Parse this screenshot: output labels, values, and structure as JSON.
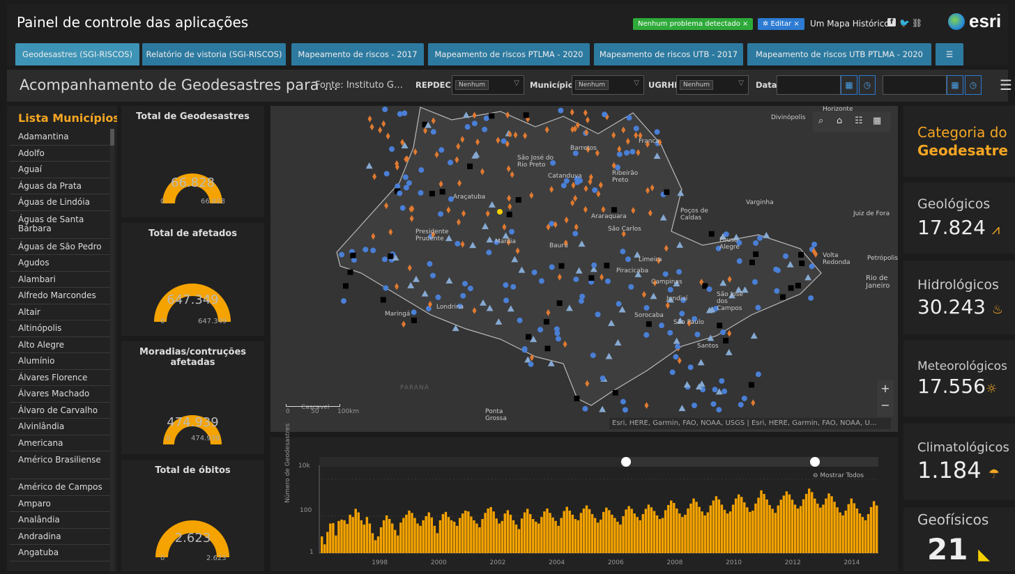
{
  "header": {
    "title": "Painel de controle das aplicações",
    "status_badge": "Nenhum problema detectado ×",
    "edit_badge": "✲ Editar ×",
    "map_link": "Um Mapa Histórico",
    "logo_text": "esri"
  },
  "tabs": [
    {
      "label": "Geodesastres (SGI-RISCOS)"
    },
    {
      "label": "Relatório de vistoria (SGI-RISCOS)"
    },
    {
      "label": "Mapeamento de riscos - 2017"
    },
    {
      "label": "Mapeamento de riscos PTLMA - 2020"
    },
    {
      "label": "Mapeamento de riscos UTB - 2017"
    },
    {
      "label": "Mapeamento de riscos UTB PTLMA - 2020"
    }
  ],
  "filters": {
    "title": "Acompanhamento de Geodesastres para …",
    "source": "Fonte: Instituto G…",
    "repdec_label": "REPDEC",
    "repdec_value": "Nenhum",
    "municipio_label": "Município",
    "municipio_value": "Nenhum",
    "ugrhi_label": "UGRHI",
    "ugrhi_value": "Nenhum",
    "data_label": "Data"
  },
  "municipios": {
    "title": "Lista Municípios",
    "items": [
      "Adamantina",
      "Adolfo",
      "Aguaí",
      "Águas da Prata",
      "Águas de Lindóia",
      "Águas de Santa Bárbara",
      "Águas de São Pedro",
      "Agudos",
      "Alambari",
      "Alfredo Marcondes",
      "Altair",
      "Altinópolis",
      "Alto Alegre",
      "Alumínio",
      "Álvares Florence",
      "Álvares Machado",
      "Álvaro de Carvalho",
      "Alvinlândia",
      "Americana",
      "Américo Brasiliense",
      "Américo de Campos",
      "Amparo",
      "Analândia",
      "Andradina",
      "Angatuba"
    ]
  },
  "gauges": [
    {
      "title": "Total de Geodesastres",
      "value": "66.828",
      "min": "0",
      "max": "66.828",
      "fill": 1.0
    },
    {
      "title": "Total de afetados",
      "value": "647.349",
      "min": "0",
      "max": "647.349",
      "fill": 1.0
    },
    {
      "title": "Moradias/contruções afetadas",
      "value": "474.939",
      "min": "0",
      "max": "474.939",
      "fill": 1.0
    },
    {
      "title": "Total de óbitos",
      "value": "2.623",
      "min": "0",
      "max": "2.623",
      "fill": 1.0
    }
  ],
  "map": {
    "labels": {
      "divinopolis": "Divinópolis",
      "horizonte": "Horizonte",
      "barretos": "Barretos",
      "franca": "Franca",
      "sjrp": "São José do Rio Preto",
      "catanduva": "Catanduva",
      "ribeirao": "Ribeirão Preto",
      "aracatuba": "Araçatuba",
      "araraquara": "Araraquara",
      "sao_carlos": "São Carlos",
      "pocos": "Poços de Caldas",
      "varginha": "Varginha",
      "juiz": "Juiz de Fora",
      "pres_prudente": "Presidente Prudente",
      "marilia": "Marília",
      "bauru": "Bauru",
      "limeira": "Limeira",
      "piracicaba": "Piracicaba",
      "campinas": "Campinas",
      "pouso": "Pouso Alegre",
      "volta": "Volta Redonda",
      "petropolis": "Petrópolis",
      "rio": "Rio de Janeiro",
      "jundiai": "Jundiaí",
      "sjc": "São José dos Campos",
      "sorocaba": "Sorocaba",
      "sao_paulo": "São Paulo",
      "santos": "Santos",
      "londrina": "Londrina",
      "maringa": "Maringá",
      "parana": "PARANÁ",
      "ponta_grossa": "Ponta Grossa",
      "cascavel": "Cascavel"
    },
    "scale": {
      "zero": "0",
      "mid": "50",
      "end": "100km"
    },
    "attribution": "Esri, HERE, Garmin, FAO, NOAA, USGS | Esri, HERE, Garmin, FAO, NOAA, U…",
    "zoom_in": "+",
    "zoom_out": "−"
  },
  "chart_data": {
    "type": "bar",
    "ylabel": "Número de Geodesastres",
    "yscale": "log",
    "yticks": [
      "10k",
      "100",
      "1"
    ],
    "xticks": [
      "1998",
      "2000",
      "2002",
      "2004",
      "2006",
      "2008",
      "2010",
      "2012",
      "2014"
    ],
    "xrange": [
      1996.0,
      2014.9
    ],
    "show_all_label": "Mostrar Todos",
    "color": "#f5a300",
    "values": [
      8,
      3,
      14,
      40,
      42,
      9,
      55,
      65,
      60,
      38,
      120,
      90,
      250,
      160,
      60,
      35,
      90,
      40,
      12,
      5,
      8,
      25,
      60,
      110,
      70,
      40,
      18,
      9,
      45,
      80,
      120,
      200,
      150,
      80,
      40,
      30,
      60,
      100,
      160,
      85,
      30,
      12,
      60,
      130,
      170,
      90,
      60,
      50,
      30,
      80,
      140,
      200,
      180,
      95,
      60,
      40,
      25,
      70,
      150,
      260,
      310,
      180,
      75,
      40,
      55,
      140,
      210,
      120,
      60,
      35,
      20,
      75,
      160,
      250,
      130,
      70,
      50,
      40,
      90,
      180,
      260,
      150,
      85,
      55,
      30,
      80,
      190,
      320,
      200,
      120,
      70,
      60,
      150,
      260,
      380,
      240,
      130,
      80,
      45,
      65,
      170,
      290,
      210,
      120,
      80,
      50,
      35,
      100,
      230,
      350,
      250,
      140,
      90,
      60,
      130,
      250,
      420,
      300,
      190,
      110,
      70,
      80,
      210,
      400,
      700,
      520,
      260,
      140,
      90,
      120,
      260,
      480,
      900,
      600,
      320,
      180,
      110,
      160,
      380,
      700,
      1200,
      800,
      420,
      220,
      140,
      180,
      420,
      900,
      1500,
      1100,
      560,
      300,
      170,
      200,
      480,
      1000,
      2500,
      1600,
      800,
      400,
      250,
      150,
      380,
      780,
      1300,
      2200,
      1500,
      780,
      420,
      260,
      350,
      820,
      1600,
      3100,
      2000,
      900,
      480,
      290,
      420,
      900,
      1700,
      1200,
      600,
      300,
      160,
      110,
      200,
      450,
      900,
      500,
      260,
      140,
      90,
      60,
      130,
      310,
      650,
      380
    ]
  },
  "categories": [
    {
      "label": "Categoria do",
      "value": "Geodesatre",
      "color": "#f5a623"
    },
    {
      "label": "Geológicos",
      "value": "17.824",
      "icon": "landslide-icon"
    },
    {
      "label": "Hidrológicos",
      "value": "30.243",
      "icon": "flood-icon"
    },
    {
      "label": "Meteorológicos",
      "value": "17.556",
      "icon": "storm-sun-icon"
    },
    {
      "label": "Climatológicos",
      "value": "1.184",
      "icon": "hail-icon"
    },
    {
      "label": "Geofísicos",
      "value": "21",
      "icon": "earthquake-icon"
    }
  ]
}
